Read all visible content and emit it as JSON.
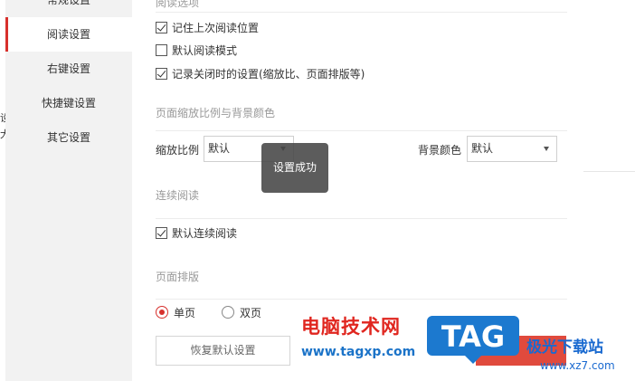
{
  "sidebar": {
    "items": [
      {
        "label": "常规设置"
      },
      {
        "label": "阅读设置"
      },
      {
        "label": "右键设置"
      },
      {
        "label": "快捷键设置"
      },
      {
        "label": "其它设置"
      }
    ],
    "active_index": 1
  },
  "reading_options": {
    "title": "阅读选项",
    "remember_position": {
      "label": "记住上次阅读位置",
      "checked": true
    },
    "default_reading_mode": {
      "label": "默认阅读模式",
      "checked": false
    },
    "record_close_settings": {
      "label": "记录关闭时的设置(缩放比、页面排版等)",
      "checked": true
    }
  },
  "zoom_background": {
    "title": "页面缩放比例与背景颜色",
    "zoom_label": "缩放比例",
    "zoom_value": "默认",
    "bg_label": "背景颜色",
    "bg_value": "默认"
  },
  "continuous": {
    "title": "连续阅读",
    "default_continuous": {
      "label": "默认连续阅读",
      "checked": true
    }
  },
  "layout": {
    "title": "页面排版",
    "single": {
      "label": "单页",
      "checked": true
    },
    "double": {
      "label": "双页",
      "checked": false
    }
  },
  "buttons": {
    "restore_label": "恢复默认设置"
  },
  "toast": {
    "text": "设置成功"
  },
  "background_peek": {
    "chars": [
      "设",
      "大"
    ]
  },
  "watermark": {
    "cn_text": "电脑技术网",
    "url": "www.tagxp.com",
    "tag_text": "TAG",
    "cn_text2": "极光下载站",
    "url2": "www.xz7.com"
  },
  "colors": {
    "accent": "#d7302c",
    "sidebar_bg": "#f2f2f2",
    "toast_bg": "#464646",
    "tag_blue": "#1c79cf"
  }
}
